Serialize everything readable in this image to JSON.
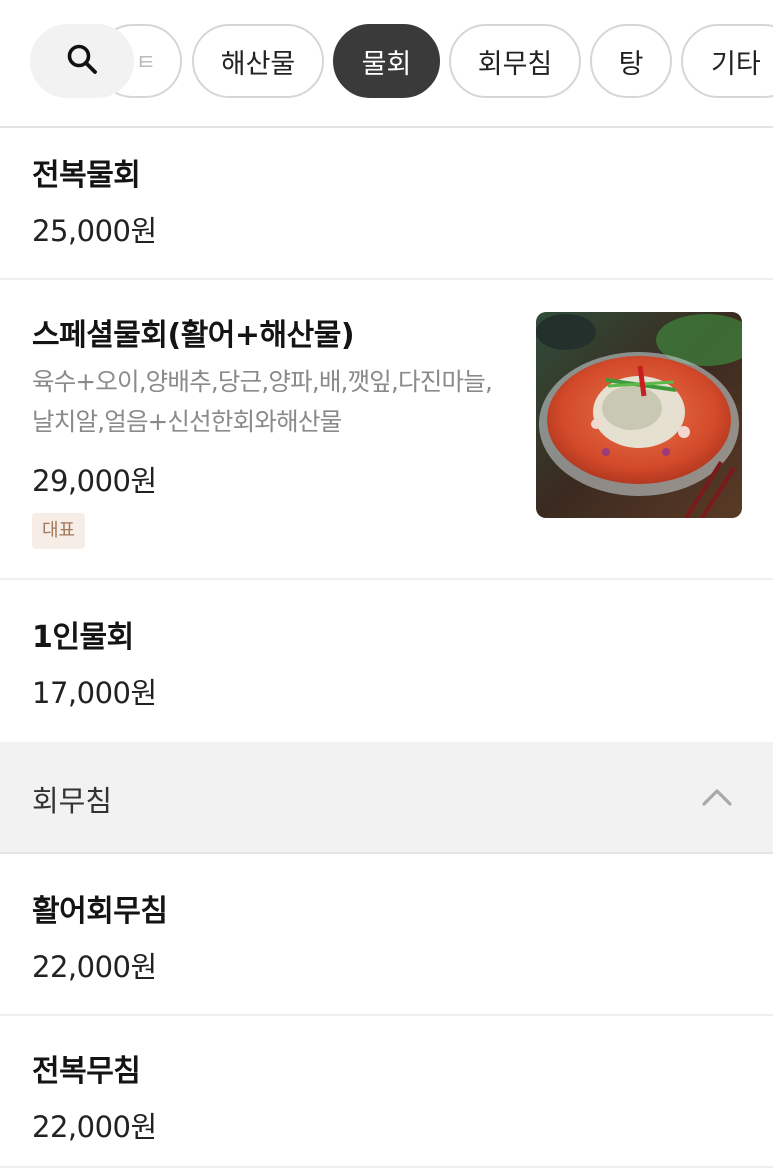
{
  "categories": {
    "search_label": "",
    "chips": [
      {
        "label": "ㅌ",
        "state": "partial"
      },
      {
        "label": "해산물",
        "state": "default"
      },
      {
        "label": "물회",
        "state": "active"
      },
      {
        "label": "회무침",
        "state": "default"
      },
      {
        "label": "탕",
        "state": "default"
      },
      {
        "label": "기타",
        "state": "default"
      }
    ]
  },
  "mulhoe_items": [
    {
      "name": "전복물회",
      "price": "25,000원"
    },
    {
      "name": "스페셜물회(활어+해산물)",
      "description": "육수+오이,양배추,당근,양파,배,깻잎,다진마늘,날치알,얼음+신선한회와해산물",
      "price": "29,000원",
      "badge": "대표",
      "image_icon": "bowl-of-cold-raw-fish-soup"
    },
    {
      "name": "1인물회",
      "price": "17,000원"
    }
  ],
  "section": {
    "title": "회무침",
    "state": "expanded",
    "items": [
      {
        "name": "활어회무침",
        "price": "22,000원"
      },
      {
        "name": "전복무침",
        "price": "22,000원"
      }
    ]
  },
  "colors": {
    "active_chip": "#3a3a3a",
    "badge_bg": "#f5ede6",
    "badge_text": "#a3775a",
    "section_bg": "#f2f2f2"
  }
}
